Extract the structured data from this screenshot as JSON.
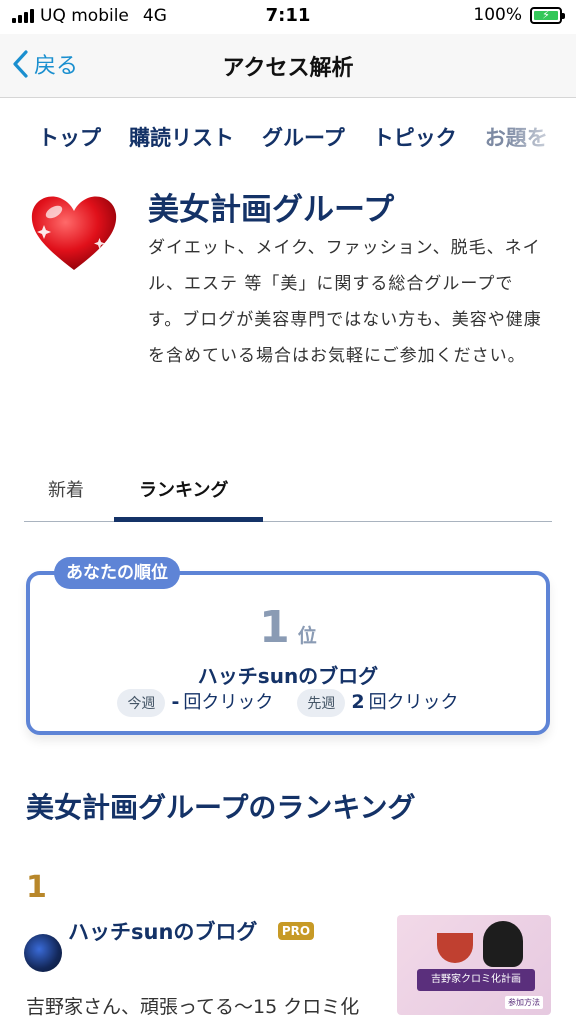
{
  "status_bar": {
    "carrier": "UQ mobile",
    "network": "4G",
    "time": "7:11",
    "battery": "100%"
  },
  "nav": {
    "back_label": "戻る",
    "title": "アクセス解析"
  },
  "tabs": [
    "トップ",
    "購読リスト",
    "グループ",
    "トピック",
    "お題を"
  ],
  "group": {
    "icon": "heart-icon",
    "title": "美女計画グループ",
    "description": "ダイエット、メイク、ファッション、脱毛、ネイル、エステ 等「美」に関する総合グループです。ブログが美容専門ではない方も、美容や健康を含めている場合はお気軽にご参加ください。"
  },
  "segments": {
    "items": [
      "新着",
      "ランキング"
    ],
    "active": "ランキング"
  },
  "your_rank": {
    "badge": "あなたの順位",
    "rank": "1",
    "rank_unit": "位",
    "blog_name": "ハッチsunのブログ",
    "this_week_label": "今週",
    "this_week_value": "-",
    "last_week_label": "先週",
    "last_week_value": "2",
    "click_unit": "回クリック"
  },
  "ranking": {
    "title": "美女計画グループのランキング",
    "entries": [
      {
        "position": "1",
        "blog": "ハッチsunのブログ",
        "badge": "PRO",
        "thumb_text": "吉野家クロミ化計画",
        "thumb_button": "参加方法",
        "snippet": "吉野家さん、頑張ってる〜15 クロミ化"
      }
    ]
  },
  "colors": {
    "accent": "#143267",
    "link": "#1a8fcf",
    "card_border": "#5e84d6",
    "rank_gold": "#b8872a"
  }
}
